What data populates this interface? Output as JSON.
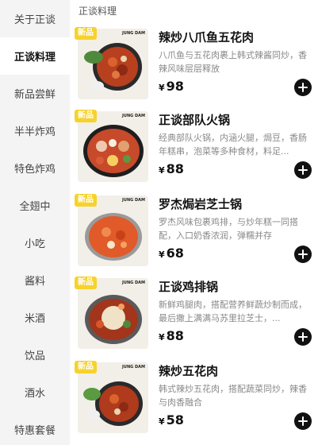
{
  "sidebar": {
    "items": [
      {
        "label": "关于正谈"
      },
      {
        "label": "正谈料理"
      },
      {
        "label": "新品尝鲜"
      },
      {
        "label": "半半炸鸡"
      },
      {
        "label": "特色炸鸡"
      },
      {
        "label": "全翅中"
      },
      {
        "label": "小吃"
      },
      {
        "label": "酱料"
      },
      {
        "label": "米酒"
      },
      {
        "label": "饮品"
      },
      {
        "label": "酒水"
      },
      {
        "label": "特惠套餐"
      }
    ],
    "active_index": 1
  },
  "main": {
    "section_title": "正谈料理",
    "currency": "¥",
    "badge": "新品",
    "brand": "JUNG DAM",
    "products": [
      {
        "name": "辣炒八爪鱼五花肉",
        "desc": "八爪鱼与五花肉裹上韩式辣酱同炒，香辣风味层层释放",
        "price": "98",
        "icon": "plus-icon"
      },
      {
        "name": "正谈部队火锅",
        "desc": "经典部队火锅，内涵火腿，焗豆，香肠年糕串，泡菜等多种食材，料足...",
        "price": "88",
        "icon": "plus-icon"
      },
      {
        "name": "罗杰焗岩芝士锅",
        "desc": "罗杰风味包裹鸡排，与炒年糕一同搭配，入口奶香浓润，弹糯并存",
        "price": "68",
        "icon": "plus-icon"
      },
      {
        "name": "正谈鸡排锅",
        "desc": "新鲜鸡腿肉，搭配营养鲜蔬炒制而成，最后撒上满满马苏里拉芝士，...",
        "price": "88",
        "icon": "plus-icon"
      },
      {
        "name": "辣炒五花肉",
        "desc": "韩式辣炒五花肉，搭配蔬菜同炒，辣香与肉香融合",
        "price": "58",
        "icon": "plus-icon"
      }
    ]
  },
  "colors": {
    "badge": "#f6d22c",
    "sidebar_bg": "#f4f4f4",
    "add_button": "#111111"
  }
}
